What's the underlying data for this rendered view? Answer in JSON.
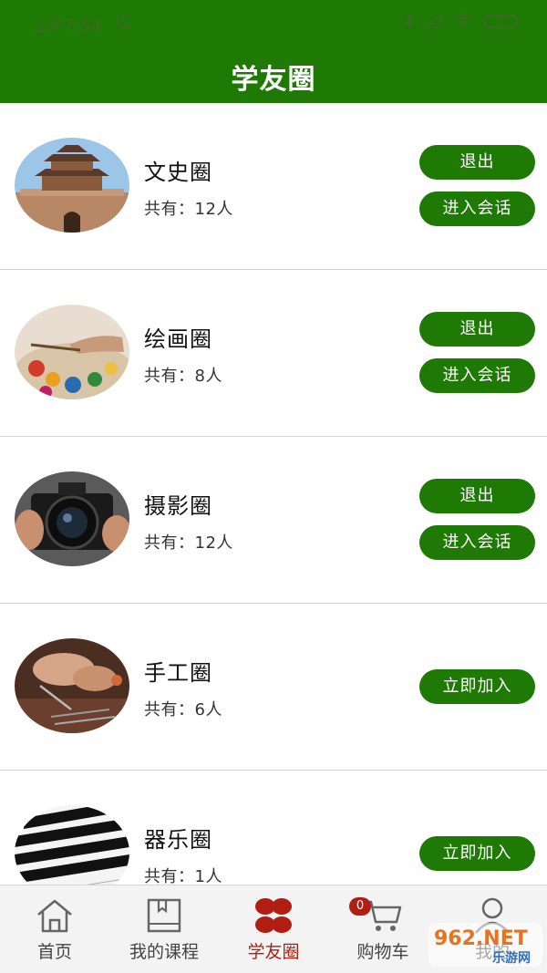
{
  "status_bar": {
    "time": "上午7:54",
    "battery": "97"
  },
  "header": {
    "title": "学友圈"
  },
  "circles": [
    {
      "name": "文史圈",
      "count": "共有：12人",
      "joined": true,
      "exit_label": "退出",
      "enter_label": "进入会话",
      "image": "ancient-tower"
    },
    {
      "name": "绘画圈",
      "count": "共有：8人",
      "joined": true,
      "exit_label": "退出",
      "enter_label": "进入会话",
      "image": "painting-palette"
    },
    {
      "name": "摄影圈",
      "count": "共有：12人",
      "joined": true,
      "exit_label": "退出",
      "enter_label": "进入会话",
      "image": "camera"
    },
    {
      "name": "手工圈",
      "count": "共有：6人",
      "joined": false,
      "join_label": "立即加入",
      "image": "handcraft-tools"
    },
    {
      "name": "器乐圈",
      "count": "共有：1人",
      "joined": false,
      "join_label": "立即加入",
      "image": "piano-keys"
    }
  ],
  "bottom_nav": {
    "items": [
      {
        "label": "首页",
        "icon": "home-icon",
        "active": false
      },
      {
        "label": "我的课程",
        "icon": "book-icon",
        "active": false
      },
      {
        "label": "学友圈",
        "icon": "clover-icon",
        "active": true
      },
      {
        "label": "购物车",
        "icon": "cart-icon",
        "active": false
      },
      {
        "label": "我的",
        "icon": "user-icon",
        "active": false
      }
    ],
    "cart_badge": "0"
  },
  "watermark": {
    "text": "962.NET",
    "subtext": "乐游网"
  },
  "colors": {
    "primary_green": "#1f7a05",
    "active_red": "#b01e12",
    "divider": "#d0d0d0"
  }
}
